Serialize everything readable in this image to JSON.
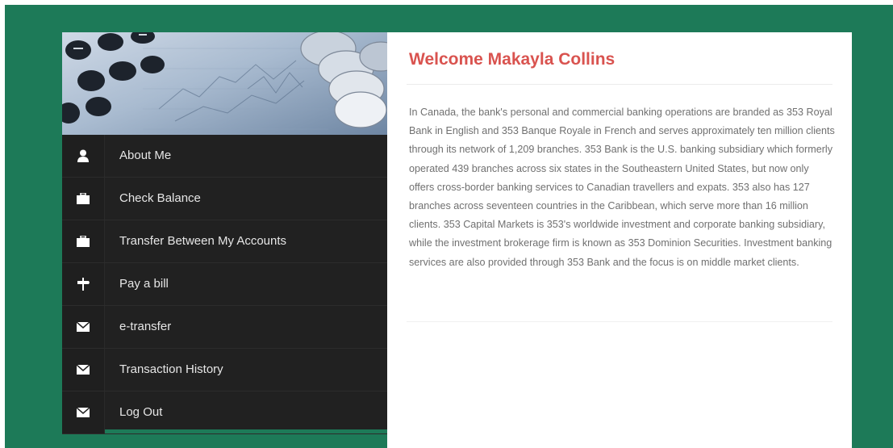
{
  "menu": {
    "items": [
      {
        "label": "About Me",
        "icon": "user-icon"
      },
      {
        "label": "Check Balance",
        "icon": "briefcase-icon"
      },
      {
        "label": "Transfer Between My Accounts",
        "icon": "briefcase-icon"
      },
      {
        "label": "Pay a bill",
        "icon": "signpost-icon"
      },
      {
        "label": "e-transfer",
        "icon": "envelope-icon"
      },
      {
        "label": "Transaction History",
        "icon": "envelope-icon"
      },
      {
        "label": "Log Out",
        "icon": "envelope-icon"
      }
    ]
  },
  "main": {
    "title": "Welcome Makayla Collins",
    "paragraph": "In Canada, the bank's personal and commercial banking operations are branded as 353 Royal Bank in English and 353 Banque Royale in French and serves approximately ten million clients through its network of 1,209 branches. 353 Bank is the U.S. banking subsidiary which formerly operated 439 branches across six states in the Southeastern United States, but now only offers cross-border banking services to Canadian travellers and expats. 353 also has 127 branches across seventeen countries in the Caribbean, which serve more than 16 million clients. 353 Capital Markets is 353's worldwide investment and corporate banking subsidiary, while the investment brokerage firm is known as 353 Dominion Securities. Investment banking services are also provided through 353 Bank and the focus is on middle market clients."
  },
  "colors": {
    "page_background": "#1d7a58",
    "sidebar": "#212121",
    "title": "#d9534f",
    "body_text": "#707070"
  }
}
